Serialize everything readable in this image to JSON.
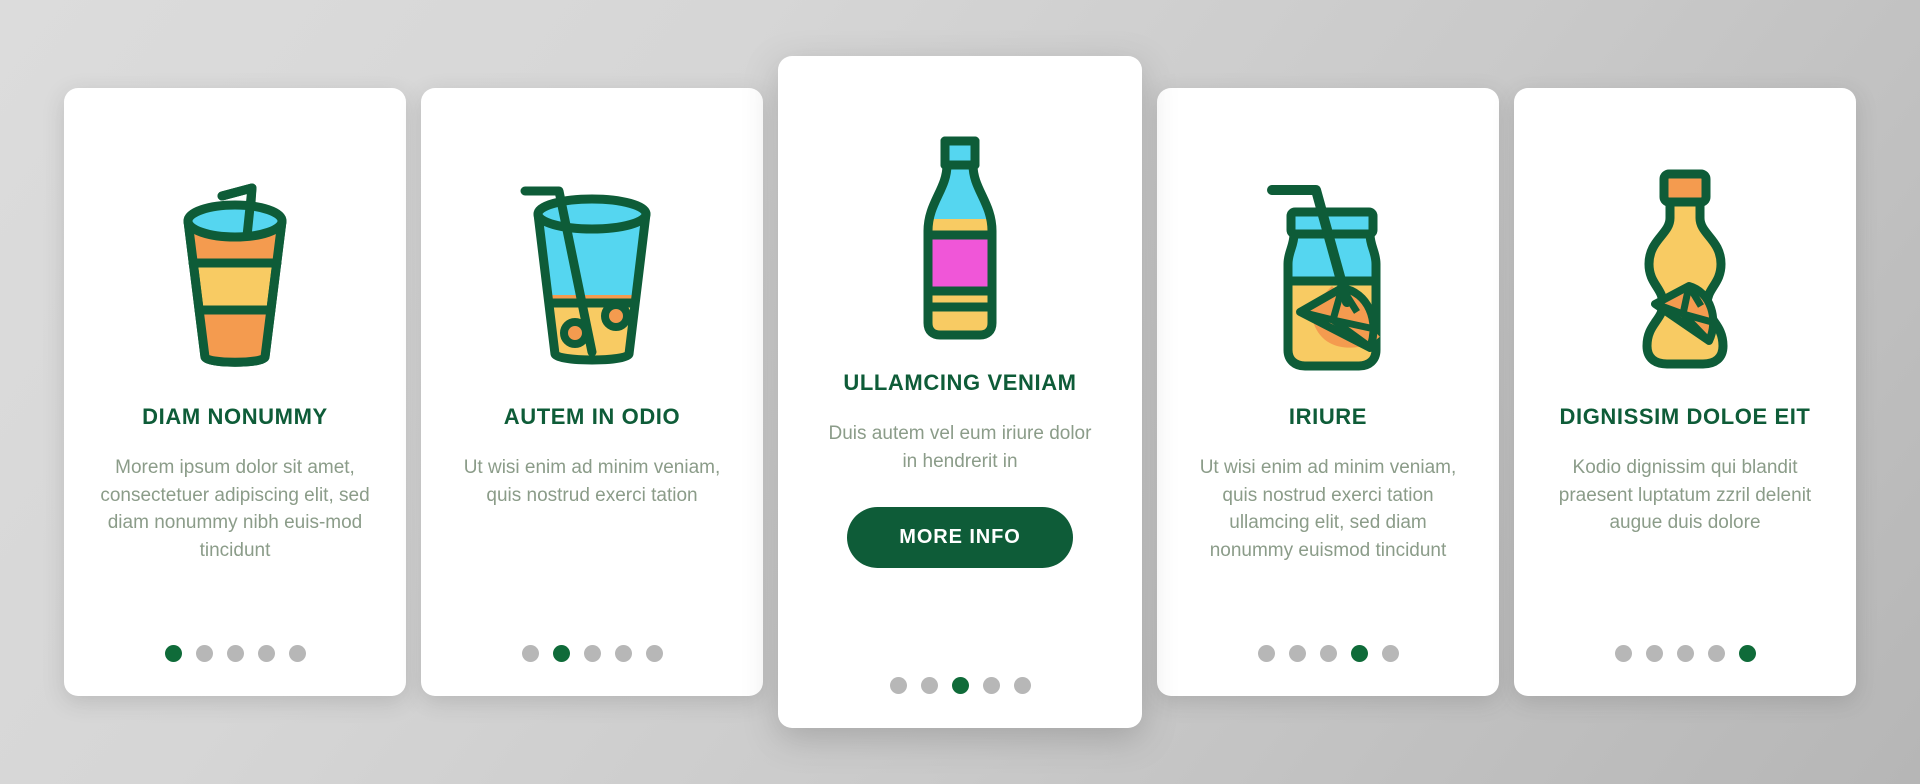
{
  "theme": {
    "accent_green": "#0e5c38",
    "dot_active": "#0f6b39",
    "dot_inactive": "#b7b7b7",
    "card_bg": "#ffffff",
    "body_text": "#8b9c89",
    "icon_outline": "#0e5c38",
    "icon_cyan": "#55d6f0",
    "icon_yellow": "#f8cb63",
    "icon_orange": "#f49b4f",
    "icon_magenta": "#f056d8",
    "page_bg_light": "#dcdcdc",
    "page_bg_dark": "#b6b6b6"
  },
  "cards": [
    {
      "id": "card-1",
      "icon": "soda-cup-with-straw-icon",
      "title": "DIAM NONUMMY",
      "body": "Morem ipsum dolor sit amet, consectetuer adipiscing elit, sed diam nonummy nibh euis-mod tincidunt",
      "dots": {
        "count": 5,
        "active_index": 0
      },
      "has_button": false,
      "featured": false
    },
    {
      "id": "card-2",
      "icon": "juice-glass-with-straw-icon",
      "title": "AUTEM IN ODIO",
      "body": "Ut wisi enim ad minim veniam, quis nostrud exerci tation",
      "dots": {
        "count": 5,
        "active_index": 1
      },
      "has_button": false,
      "featured": false
    },
    {
      "id": "card-3",
      "icon": "soda-bottle-icon",
      "title": "ULLAMCING VENIAM",
      "body": "Duis autem vel eum iriure dolor in hendrerit in",
      "button_label": "MORE INFO",
      "dots": {
        "count": 5,
        "active_index": 2
      },
      "has_button": true,
      "featured": true
    },
    {
      "id": "card-4",
      "icon": "lemonade-jar-with-straw-icon",
      "title": "IRIURE",
      "body": "Ut wisi enim ad minim veniam, quis nostrud exerci tation ullamcing elit, sed diam nonummy euismod tincidunt",
      "dots": {
        "count": 5,
        "active_index": 3
      },
      "has_button": false,
      "featured": false
    },
    {
      "id": "card-5",
      "icon": "juice-bottle-with-lemon-icon",
      "title": "DIGNISSIM DOLOE EIT",
      "body": "Kodio dignissim qui blandit praesent luptatum zzril delenit augue duis dolore",
      "dots": {
        "count": 5,
        "active_index": 4
      },
      "has_button": false,
      "featured": false
    }
  ]
}
